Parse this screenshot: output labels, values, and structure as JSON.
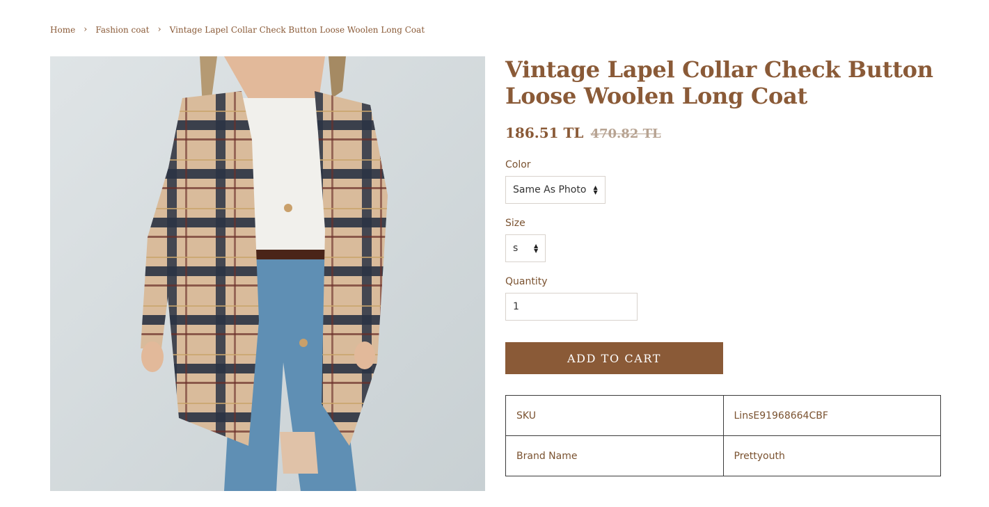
{
  "breadcrumb": {
    "items": [
      "Home",
      "Fashion coat",
      "Vintage Lapel Collar Check Button Loose Woolen Long Coat"
    ],
    "separator": "›"
  },
  "product": {
    "title": "Vintage Lapel Collar Check Button Loose Woolen Long Coat",
    "price": "186.51 TL",
    "compare_price": "470.82 TL",
    "image_alt": "Plaid long coat worn over white shirt and ripped jeans"
  },
  "options": {
    "color_label": "Color",
    "color_value": "Same As Photo",
    "size_label": "Size",
    "size_value": "s",
    "quantity_label": "Quantity",
    "quantity_value": "1"
  },
  "cart": {
    "add_label": "ADD TO CART"
  },
  "specs": [
    {
      "key": "SKU",
      "value": "LinsE91968664CBF"
    },
    {
      "key": "Brand Name",
      "value": "Prettyouth"
    }
  ],
  "colors": {
    "brand": "#8a5a37",
    "compare": "#b7a392"
  }
}
